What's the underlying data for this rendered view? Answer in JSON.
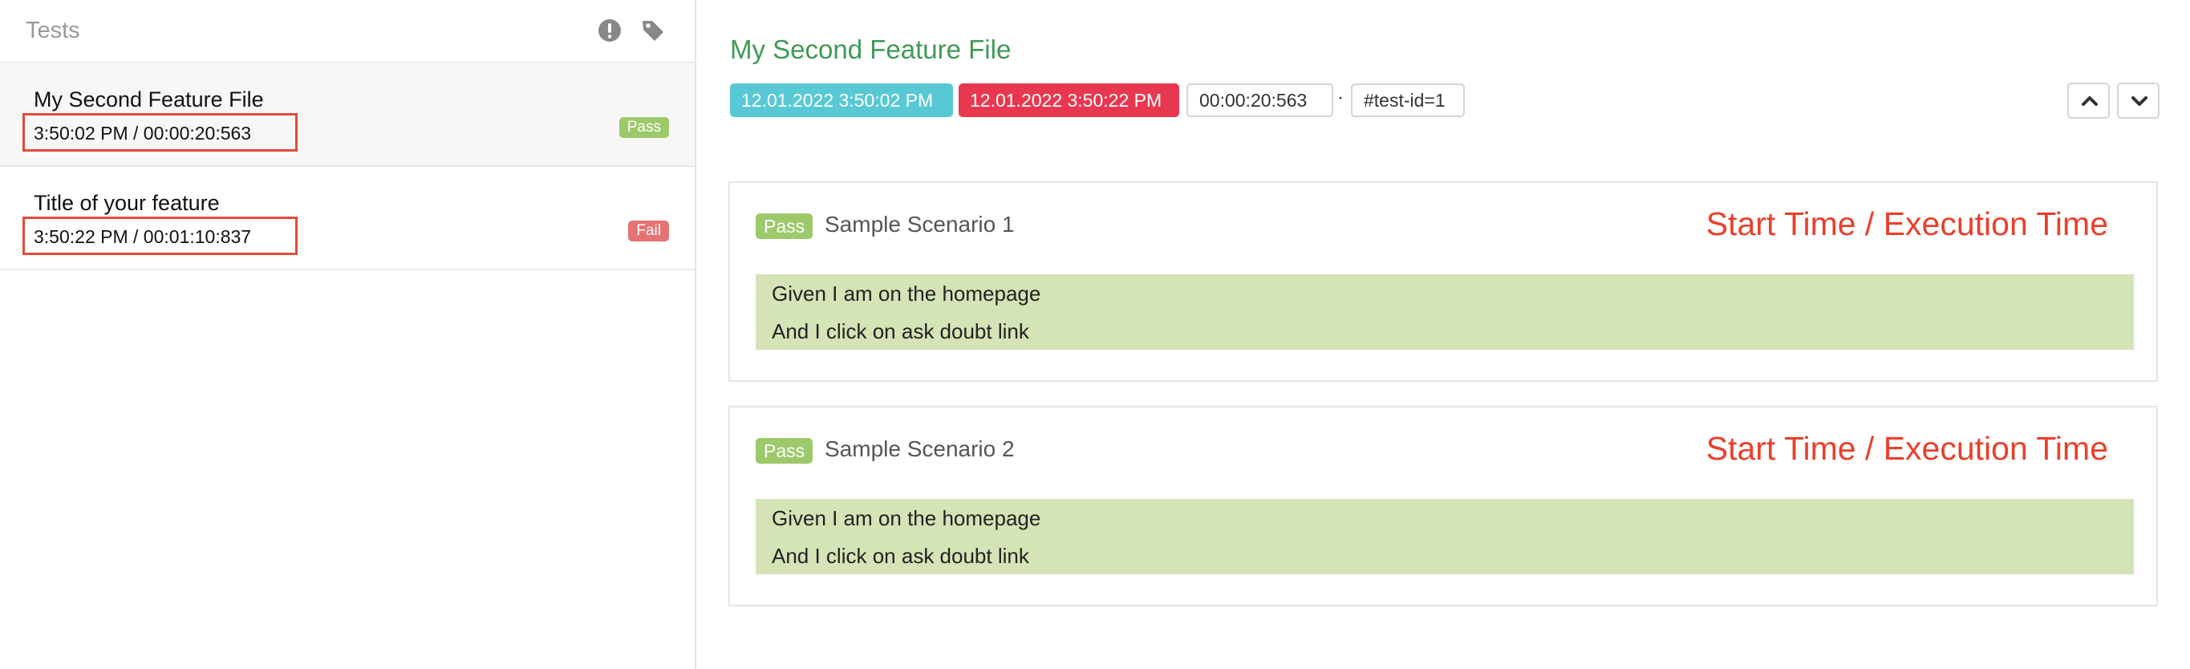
{
  "sidebar": {
    "title": "Tests",
    "icons": [
      "exclamation-circle-icon",
      "tag-icon"
    ],
    "items": [
      {
        "name": "My Second Feature File",
        "time": "3:50:02 PM / 00:00:20:563",
        "status": "Pass"
      },
      {
        "name": "Title of your feature",
        "time": "3:50:22 PM / 00:01:10:837",
        "status": "Fail"
      }
    ]
  },
  "main": {
    "title": "My Second Feature File",
    "start": "12.01.2022 3:50:02 PM",
    "end": "12.01.2022 3:50:22 PM",
    "duration": "00:00:20:563",
    "separator": "·",
    "test_id": "#test-id=1",
    "nav": [
      "chevron-up-icon",
      "chevron-down-icon"
    ],
    "scenarios": [
      {
        "status": "Pass",
        "name": "Sample Scenario 1",
        "annotation": "Start Time / Execution Time",
        "steps": [
          "Given I am on the homepage",
          "And I click on ask doubt link"
        ]
      },
      {
        "status": "Pass",
        "name": "Sample Scenario 2",
        "annotation": "Start Time / Execution Time",
        "steps": [
          "Given I am on the homepage",
          "And I click on ask doubt link"
        ]
      }
    ]
  },
  "colors": {
    "pass": "#9dc96b",
    "fail": "#e57373",
    "start_chip": "#58c9d4",
    "end_chip": "#e8384f",
    "feature_title": "#3f9a55",
    "annotation": "#e8402c",
    "steps_bg": "#d4e4b6"
  }
}
